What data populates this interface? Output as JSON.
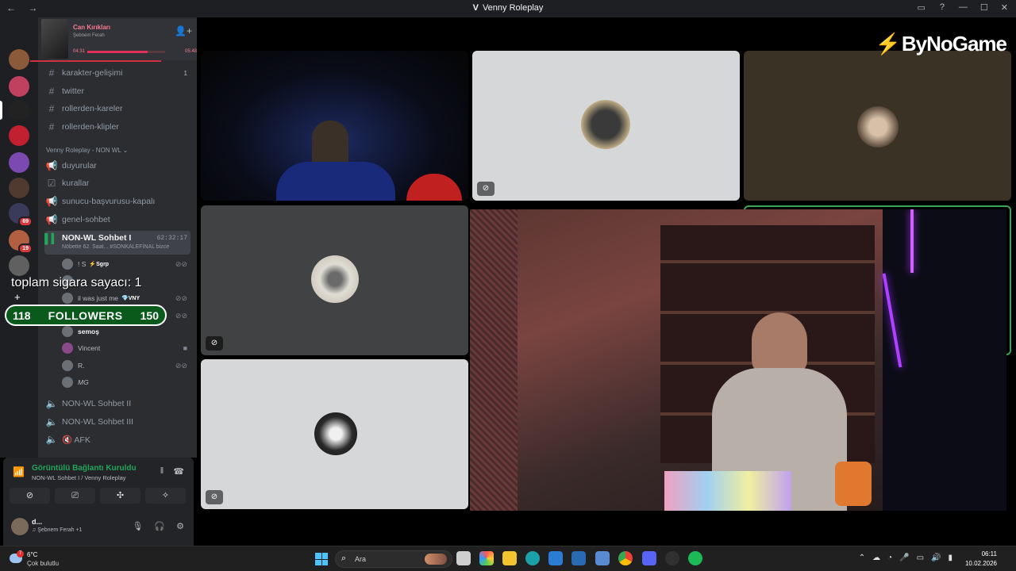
{
  "titlebar": {
    "nav": "← →",
    "app_logo": "V",
    "title": "Venny Roleplay",
    "icons": [
      "inbox-icon",
      "help-icon"
    ],
    "controls": [
      "—",
      "☐",
      "✕"
    ]
  },
  "servers": [
    {
      "icon": "server-avatar",
      "color": "#8a5a3a"
    },
    {
      "icon": "server-avatar",
      "color": "#c04060"
    },
    {
      "icon": "server-avatar",
      "color": "#222222",
      "active": true
    },
    {
      "icon": "server-avatar",
      "color": "#c02030"
    },
    {
      "icon": "server-avatar",
      "color": "#7a4ab0"
    },
    {
      "icon": "server-avatar",
      "color": "#503a30"
    },
    {
      "icon": "server-avatar",
      "color": "#3a3a5a",
      "badge": "69"
    },
    {
      "icon": "server-avatar",
      "color": "#b06040",
      "badge": "19"
    },
    {
      "icon": "server-avatar",
      "color": "#606060"
    }
  ],
  "music": {
    "title": "Can Kırıkları",
    "artist": "Şebnem Ferah",
    "elapsed": "04:31",
    "total": "05:48",
    "progress": 0.78
  },
  "channels": {
    "text": [
      {
        "name": "karakter-gelişimi",
        "count": "1"
      },
      {
        "name": "twitter"
      },
      {
        "name": "rollerden-kareler"
      },
      {
        "name": "rollerden-klipler"
      }
    ],
    "category": "Venny Roleplay - NON WL",
    "category2": [
      {
        "name": "duyurular",
        "icon": "megaphone-icon"
      },
      {
        "name": "kurallar",
        "icon": "check-icon"
      },
      {
        "name": "sunucu-başvurusu-kapalı",
        "icon": "megaphone-icon"
      },
      {
        "name": "genel-sohbet",
        "icon": "megaphone-icon"
      }
    ],
    "active_voice": {
      "name": "NON-WL Sohbet I",
      "timer": "62:32:17",
      "status": "Nöbette 62. Saat... #SONKALEFİNAL bizce"
    },
    "voice_users": [
      {
        "name": "! S",
        "tag": "⚡Sgrp"
      },
      {
        "name": "r"
      },
      {
        "name": "il was just me",
        "tag": "💎VNY"
      },
      {
        "name": ""
      },
      {
        "name": "semoş"
      },
      {
        "name": "Vincent"
      },
      {
        "name": "R."
      },
      {
        "name": "MG"
      }
    ],
    "other_voice": [
      "NON-WL Sohbet II",
      "NON-WL Sohbet III",
      "🔇 AFK"
    ]
  },
  "overlay": {
    "text": "toplam sigara sayacı: 1",
    "followers_current": "118",
    "followers_label": "FOLLOWERS",
    "followers_goal": "150"
  },
  "voice_panel": {
    "title": "Görüntülü Bağlantı Kuruldu",
    "subtitle": "NON-WL Sohbet I / Venny Roleplay"
  },
  "user_panel": {
    "name": "d...",
    "status": "♫ Şebnem Ferah +1"
  },
  "watermark": "ByNoGame",
  "taskbar": {
    "weather_temp": "6°C",
    "weather_desc": "Çok bulutlu",
    "weather_badge": "7",
    "search_placeholder": "Ara",
    "time": "06:11",
    "date": "10.02.2026"
  }
}
